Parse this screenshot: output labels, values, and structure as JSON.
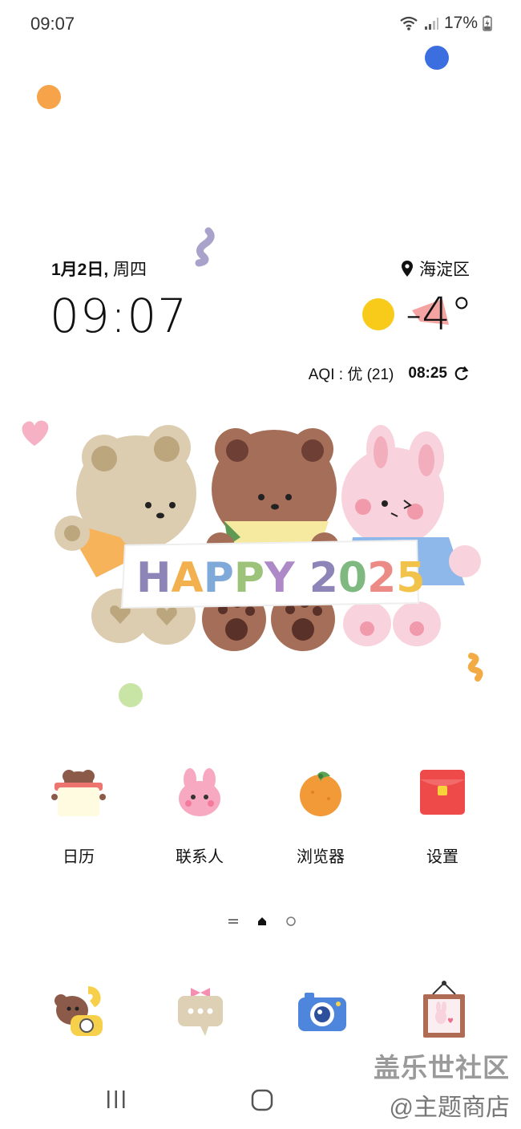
{
  "status_bar": {
    "time": "09:07",
    "battery": "17%"
  },
  "widget": {
    "date_main": "1月2日,",
    "weekday": "周四",
    "clock": "09:07",
    "location": "海淀区",
    "temperature": "-4°",
    "aqi": "AQI : 优 (21)",
    "update_time": "08:25"
  },
  "apps": [
    {
      "label": "日历"
    },
    {
      "label": "联系人"
    },
    {
      "label": "浏览器"
    },
    {
      "label": "设置"
    }
  ],
  "dock": [
    "phone-icon",
    "messages-icon",
    "camera-icon",
    "gallery-icon"
  ],
  "watermark": {
    "line1": "盖乐世社区",
    "line2": "@主题商店"
  },
  "colors": {
    "sun": "#f8cb1b",
    "accent_blue": "#3b6fe0",
    "orange_dot": "#f6a34a",
    "green_dot": "#c9e5a5"
  }
}
